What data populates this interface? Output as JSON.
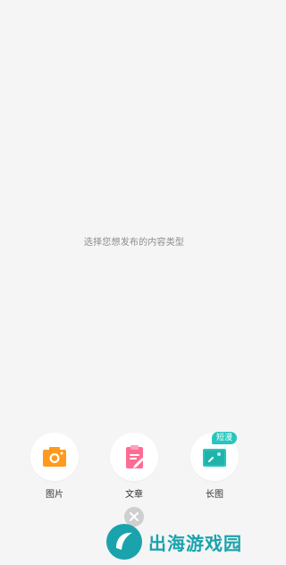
{
  "prompt_text": "选择您想发布的内容类型",
  "options": [
    {
      "label": "图片",
      "icon": "camera-icon",
      "color": "#ff9a1f"
    },
    {
      "label": "文章",
      "icon": "document-edit-icon",
      "color": "#ff6b93"
    },
    {
      "label": "长图",
      "icon": "long-image-icon",
      "color": "#27c6bd",
      "badge": "短漫"
    }
  ],
  "close_icon": "close-icon",
  "watermark": {
    "text": "出海游戏园",
    "color": "#1aa3ac"
  }
}
